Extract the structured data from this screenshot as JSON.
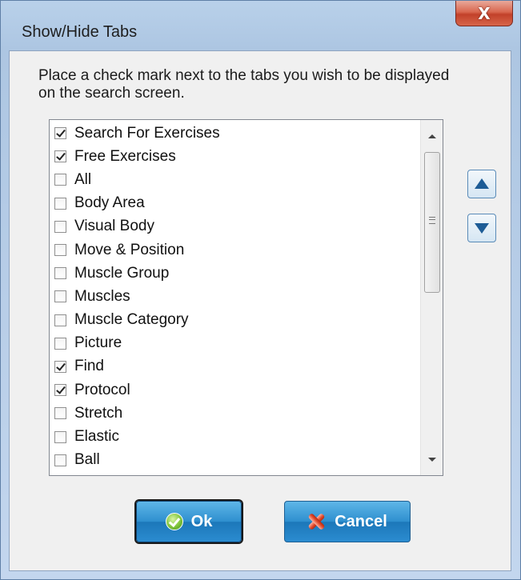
{
  "window": {
    "title": "Show/Hide Tabs",
    "close_label": "X"
  },
  "instruction": "Place a check mark next to the tabs you wish to be displayed on the search screen.",
  "tabs_list": {
    "items": [
      {
        "label": "Search For Exercises",
        "checked": true
      },
      {
        "label": "Free Exercises",
        "checked": true
      },
      {
        "label": "All",
        "checked": false
      },
      {
        "label": "Body Area",
        "checked": false
      },
      {
        "label": "Visual Body",
        "checked": false
      },
      {
        "label": "Move & Position",
        "checked": false
      },
      {
        "label": "Muscle Group",
        "checked": false
      },
      {
        "label": "Muscles",
        "checked": false
      },
      {
        "label": "Muscle Category",
        "checked": false
      },
      {
        "label": "Picture",
        "checked": false
      },
      {
        "label": "Find",
        "checked": true
      },
      {
        "label": "Protocol",
        "checked": true
      },
      {
        "label": "Stretch",
        "checked": false
      },
      {
        "label": "Elastic",
        "checked": false
      },
      {
        "label": "Ball",
        "checked": false
      }
    ]
  },
  "buttons": {
    "ok_label": "Ok",
    "cancel_label": "Cancel",
    "move_up_icon": "triangle-up-icon",
    "move_down_icon": "triangle-down-icon"
  },
  "colors": {
    "accent": "#2e8fcf",
    "close": "#c2412a",
    "arrow": "#1d5c96"
  }
}
